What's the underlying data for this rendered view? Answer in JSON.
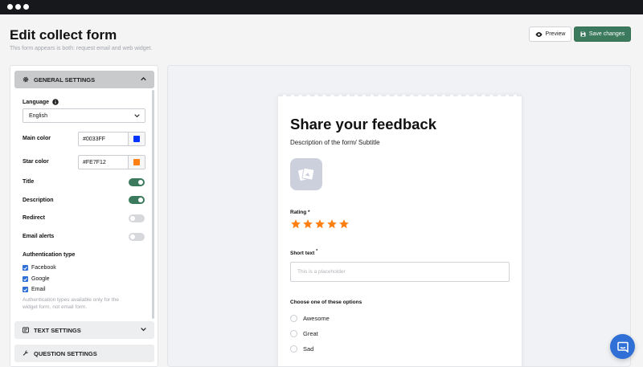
{
  "header": {
    "title": "Edit collect form",
    "subtitle": "This form appears is both: request email and web widget.",
    "preview_label": "Preview",
    "save_label": "Save changes"
  },
  "settings": {
    "general": {
      "header": "GENERAL SETTINGS",
      "language_label": "Language",
      "language_value": "English",
      "main_color_label": "Main color",
      "main_color_value": "#0033FF",
      "star_color_label": "Star color",
      "star_color_value": "#FE7F12",
      "toggles": [
        {
          "label": "Title",
          "on": true
        },
        {
          "label": "Description",
          "on": true
        },
        {
          "label": "Redirect",
          "on": false
        },
        {
          "label": "Email alerts",
          "on": false
        }
      ],
      "auth_label": "Authentication type",
      "auth_options": [
        {
          "label": "Facebook",
          "checked": true
        },
        {
          "label": "Google",
          "checked": true
        },
        {
          "label": "Email",
          "checked": true
        }
      ],
      "auth_note": "Authentication types available only for the widget form, not email form."
    },
    "text_header": "TEXT SETTINGS",
    "question_header": "QUESTION SETTINGS"
  },
  "form_preview": {
    "title": "Share your feedback",
    "description": "Description of the form/ Subtitle",
    "rating_label": "Rating",
    "required_mark": "*",
    "rating_value": 5,
    "rating_max": 5,
    "short_text_label": "Short text",
    "short_text_placeholder": "This is a placeholder",
    "choice_label": "Choose one of these options",
    "choices": [
      "Awesome",
      "Great",
      "Sad"
    ]
  },
  "colors": {
    "accent": "#3B7A5C",
    "main": "#0033FF",
    "star": "#FE7F12",
    "chat": "#2F6FD6"
  },
  "icons": {
    "preview": "eye-icon",
    "save": "save-icon",
    "general": "gear-icon",
    "info": "info-icon",
    "questions": "wrench-icon",
    "chat": "chat-icon"
  }
}
